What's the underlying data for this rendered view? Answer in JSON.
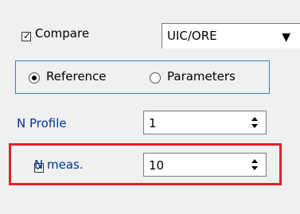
{
  "compare": {
    "label": "Compare",
    "checked": true
  },
  "combo": {
    "value": "UIC/ORE",
    "arrow_icon": "dropdown-arrow-icon"
  },
  "radio": {
    "reference_label": "Reference",
    "parameters_label": "Parameters",
    "selected": "Reference"
  },
  "n_profile": {
    "label": "N Profile",
    "value": "1"
  },
  "n_meas": {
    "label": "N meas.",
    "value": "10",
    "checked": true
  },
  "colors": {
    "highlight": "#e0202a",
    "group_border": "#3c7fb1",
    "label_blue": "#003399"
  }
}
